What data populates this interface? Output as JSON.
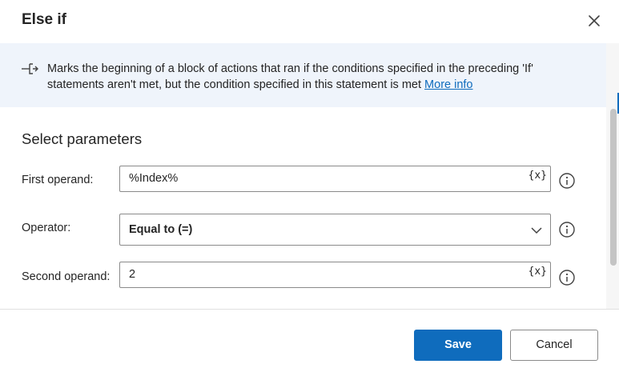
{
  "dialog": {
    "title": "Else if",
    "close_icon": "close-icon"
  },
  "info": {
    "icon": "branch-arrow-icon",
    "text": "Marks the beginning of a block of actions that ran if the conditions specified in the preceding 'If' statements aren't met, but the condition specified in this statement is met",
    "link_label": "More info"
  },
  "params": {
    "section_title": "Select parameters",
    "first_operand": {
      "label": "First operand:",
      "value": "%Index%",
      "var_button": "{x}"
    },
    "operator": {
      "label": "Operator:",
      "value": "Equal to (=)"
    },
    "second_operand": {
      "label": "Second operand:",
      "value": "2",
      "var_button": "{x}"
    }
  },
  "footer": {
    "save_label": "Save",
    "cancel_label": "Cancel"
  },
  "colors": {
    "accent": "#0f6cbd",
    "banner_bg": "#eff4fb"
  }
}
